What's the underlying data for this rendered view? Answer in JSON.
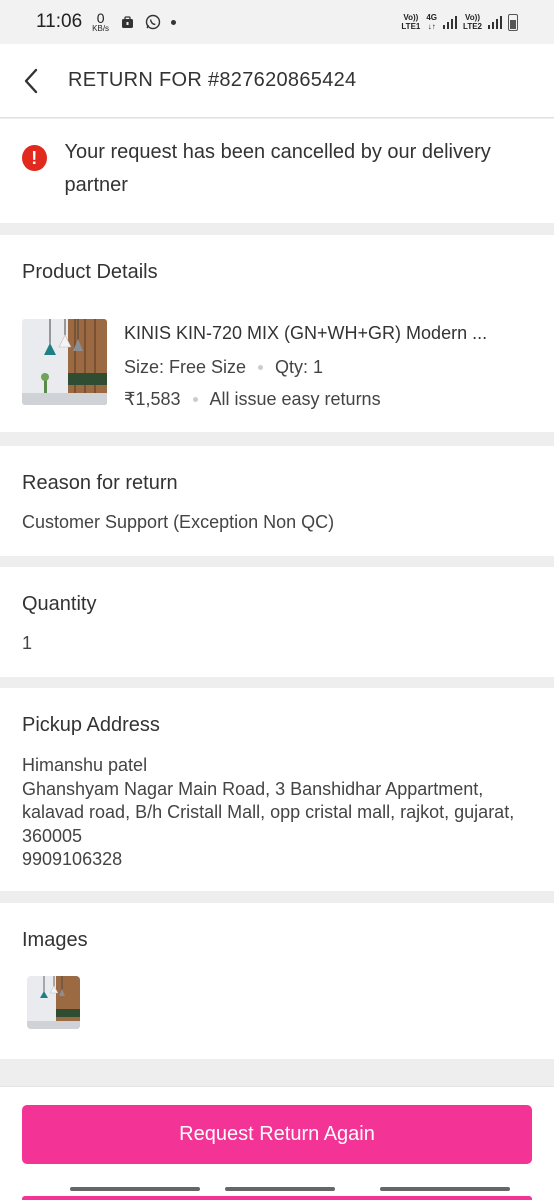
{
  "status_bar": {
    "time": "11:06",
    "speed_value": "0",
    "speed_unit": "KB/s",
    "sim1_top": "Vo))",
    "sim1_bottom": "LTE1",
    "net_type": "4G",
    "net_arrows": "↓↑",
    "sim2_top": "Vo))",
    "sim2_bottom": "LTE2"
  },
  "header": {
    "title": "RETURN FOR #827620865424"
  },
  "alert": {
    "icon": "!",
    "message": "Your request has been cancelled by our delivery partner",
    "color": "#e1291d"
  },
  "product_details": {
    "title": "Product Details",
    "name": "KINIS KIN-720 MIX (GN+WH+GR) Modern ...",
    "size": "Size: Free Size",
    "qty": "Qty: 1",
    "price": "₹1,583",
    "return_policy": "All issue easy returns"
  },
  "reason": {
    "title": "Reason for return",
    "value": "Customer Support (Exception Non QC)"
  },
  "quantity": {
    "title": "Quantity",
    "value": "1"
  },
  "pickup_address": {
    "title": "Pickup Address",
    "text": "Himanshu patel\nGhanshyam Nagar Main Road, 3 Banshidhar Appartment, kalavad road, B/h Cristall Mall, opp cristal mall, rajkot, gujarat, 360005\n9909106328"
  },
  "images": {
    "title": "Images"
  },
  "footer": {
    "cta_label": "Request Return Again",
    "accent": "#f43397"
  }
}
